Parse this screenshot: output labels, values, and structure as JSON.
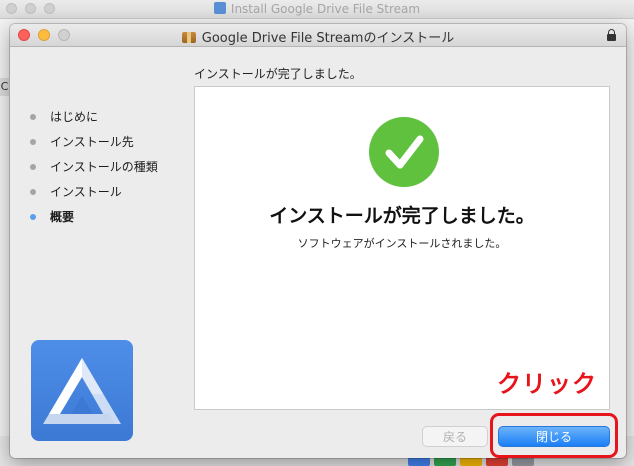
{
  "background_window": {
    "title": "Install Google Drive File Stream",
    "side_letter": "C"
  },
  "window": {
    "title": "Google Drive File Streamのインストール",
    "heading": "インストールが完了しました。"
  },
  "sidebar": {
    "steps": [
      {
        "label": "はじめに",
        "active": false
      },
      {
        "label": "インストール先",
        "active": false
      },
      {
        "label": "インストールの種類",
        "active": false
      },
      {
        "label": "インストール",
        "active": false
      },
      {
        "label": "概要",
        "active": true
      }
    ]
  },
  "panel": {
    "icon": "checkmark-icon",
    "main_message": "インストールが完了しました。",
    "sub_message": "ソフトウェアがインストールされました。"
  },
  "buttons": {
    "back_label": "戻る",
    "close_label": "閉じる"
  },
  "annotation": {
    "label": "クリック",
    "color": "#e8141c"
  },
  "colors": {
    "accent_blue": "#1b7ff6",
    "success_green": "#5fc13e",
    "drive_tile": "#4a89e3"
  }
}
